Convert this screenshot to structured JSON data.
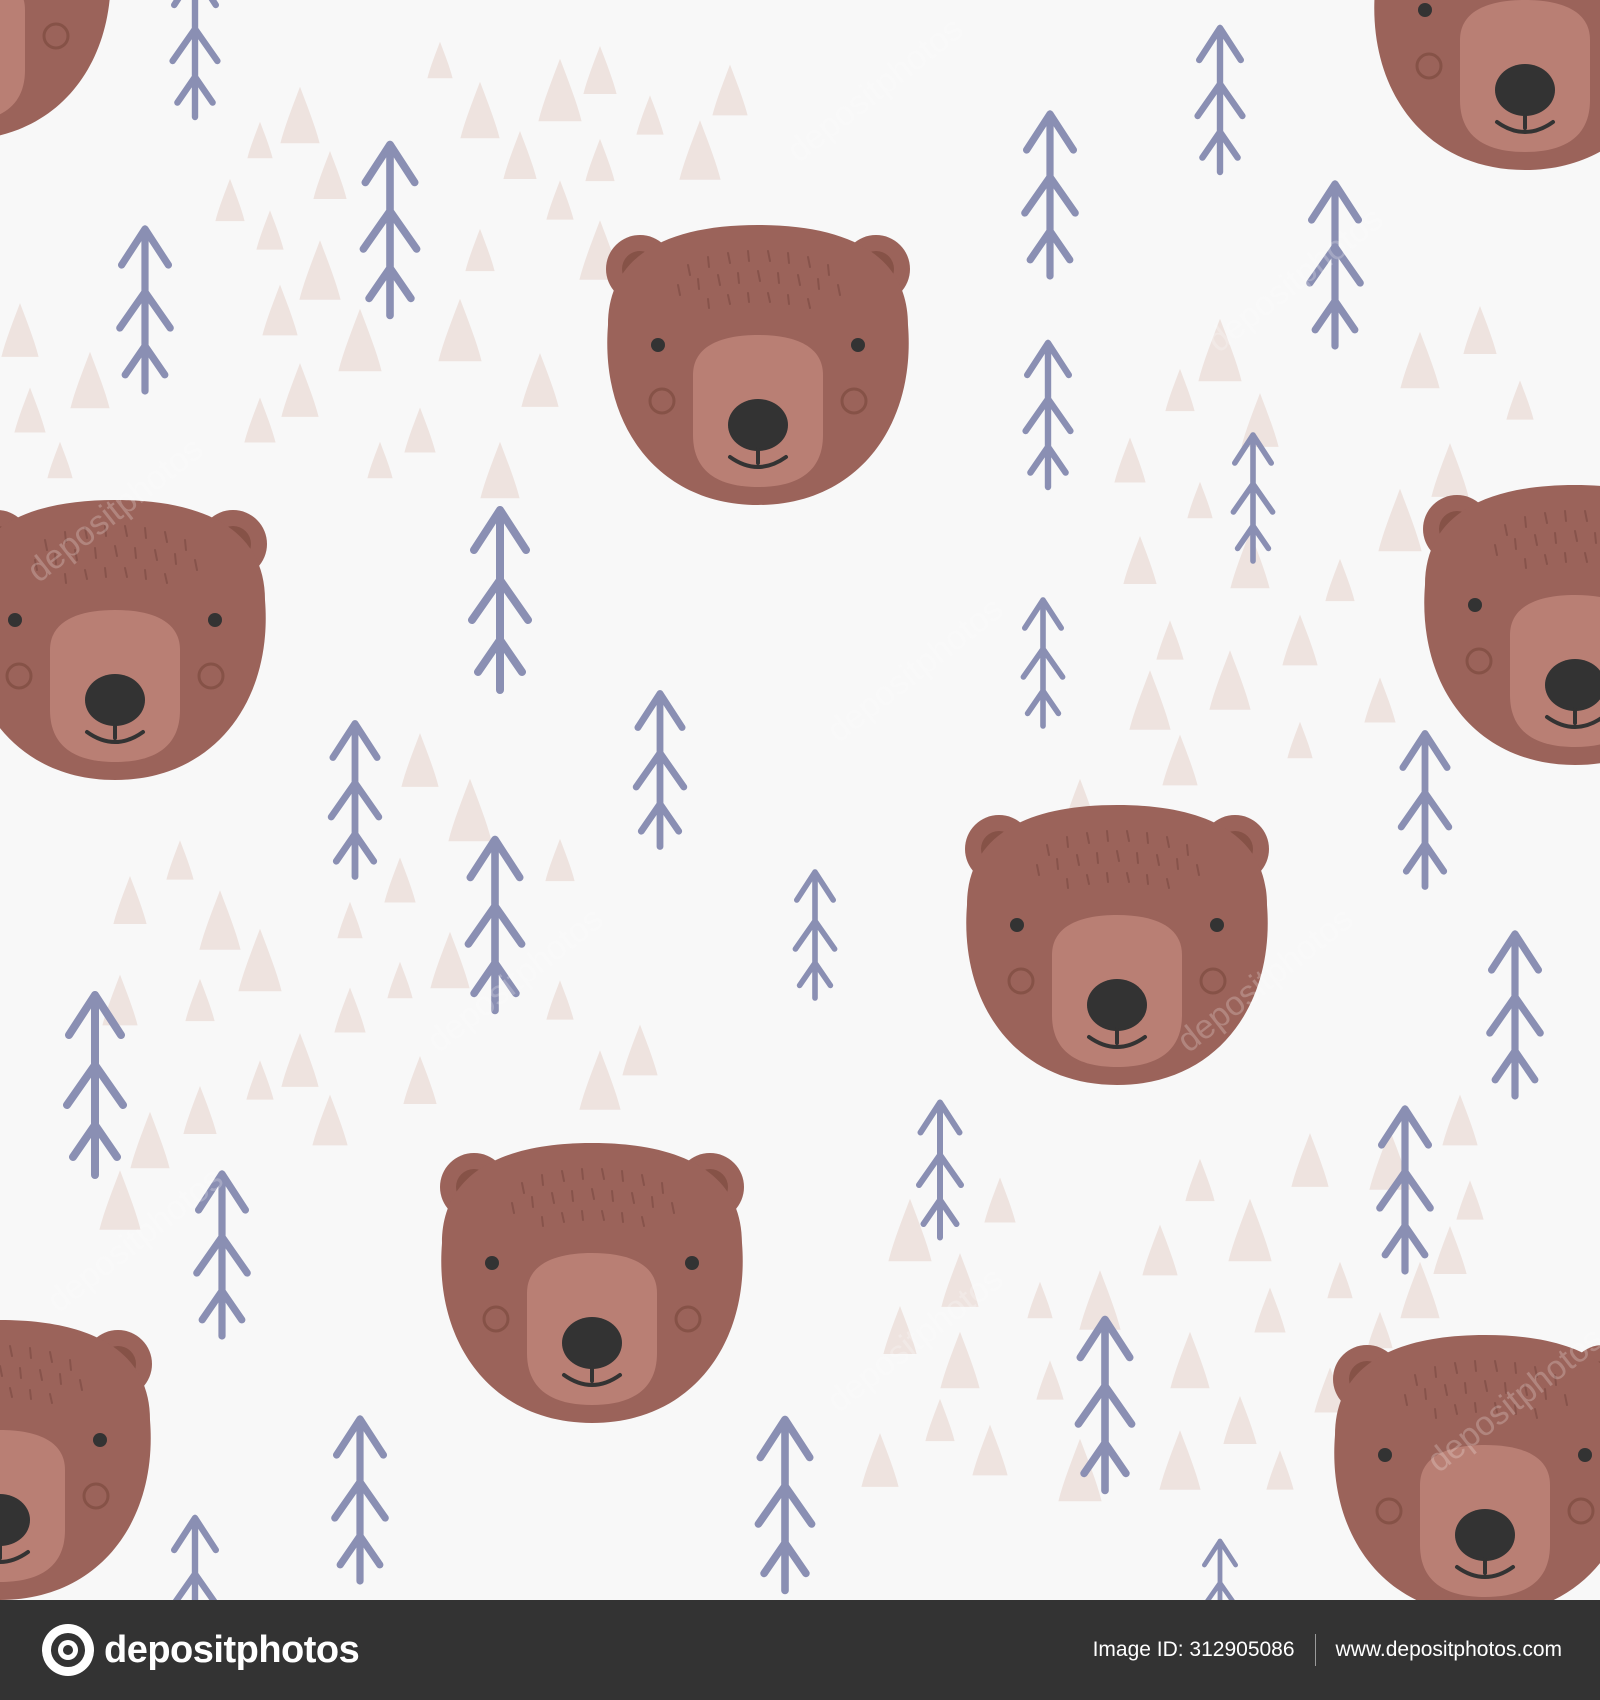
{
  "scene": {
    "description_colors": {
      "background": "#f8f8f8",
      "bear_fur": "#9b635a",
      "bear_ear_inner": "#865247",
      "bear_muzzle": "#b97f74",
      "bear_nose": "#333333",
      "tree": "#8a8fb3",
      "triangle": "#eee3df"
    }
  },
  "watermark": {
    "text": "depositphotos"
  },
  "footer": {
    "brand": "depositphotos",
    "image_id": "Image ID: 312905086",
    "website": "www.depositphotos.com",
    "background": "#333333"
  }
}
